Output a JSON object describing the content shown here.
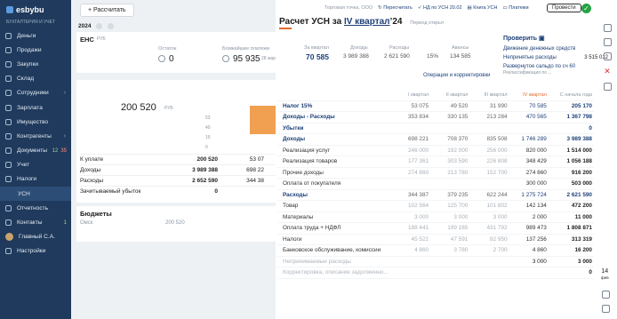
{
  "app": {
    "logo": "esbybu",
    "company": "БУХГАЛТЕРИЯ И УЧЕТ"
  },
  "sidebar": {
    "items": [
      {
        "label": "Деньги"
      },
      {
        "label": "Продажи"
      },
      {
        "label": "Закупки"
      },
      {
        "label": "Склад"
      },
      {
        "label": "Сотрудники",
        "arrow": "›"
      },
      {
        "label": "Зарплата"
      },
      {
        "label": "Имущество"
      },
      {
        "label": "Контрагенты",
        "arrow": "›"
      },
      {
        "label": "Документы",
        "badge": "12",
        "badge2": "35"
      },
      {
        "label": "Учет"
      },
      {
        "label": "Налоги"
      },
      {
        "label": "УСН"
      },
      {
        "label": "Отчетность"
      },
      {
        "label": "Контакты",
        "badge": "1"
      },
      {
        "label": "Главный С.А."
      },
      {
        "label": "Настройки"
      }
    ]
  },
  "main": {
    "calc_button": "Рассчитать",
    "year": "2024",
    "ens": {
      "title": "ЕНС",
      "currency": "РУБ",
      "balance_label": "Остаток",
      "balance_value": "0",
      "payments_label": "Ближайшие платежи",
      "payments_value": "95 935",
      "payments_date": "28 мар"
    },
    "usn": {
      "amount": "200 520",
      "currency": "РУБ",
      "chart_ticks": [
        "53",
        "40",
        "15",
        "0"
      ],
      "rows": [
        {
          "label": "К уплате",
          "value": "200 520",
          "value2": "53 07"
        },
        {
          "label": "Доходы",
          "value": "3 989 388",
          "value2": "698 22"
        },
        {
          "label": "Расходы",
          "value": "2 652 590",
          "value2": "344 38"
        },
        {
          "label": "Зачитываемый убыток",
          "value": "0",
          "value2": ""
        }
      ]
    },
    "budget": {
      "title": "Бюджеты",
      "label": "Омск",
      "value": "200 520"
    }
  },
  "panel": {
    "title_prefix": "Расчет УСН за ",
    "title_period": "IV квартал",
    "title_suffix": "’24",
    "period_status": "Период открыт",
    "links": {
      "point": "Торговая точка, ООО",
      "recalc": "Пересчитать",
      "nd": "НД по УСН 20.02",
      "book": "Книга УСН",
      "payments": "Платежи"
    },
    "check_button": "Провести",
    "calc": {
      "kv_label": "За квартал",
      "kv_value": "70 585",
      "income_label": "Доходы",
      "income_value": "3 989 388",
      "expense_label": "Расходы",
      "expense_value": "2 621 590",
      "rate": "15%",
      "adv_label": "Авансы",
      "adv_value": "134 585",
      "ops": "Операции и корректировки"
    },
    "check": {
      "title": "Проверить",
      "items": [
        {
          "label": "Движение денежных средств",
          "value": ""
        },
        {
          "label": "Непринятые расходы",
          "value": "3 515 012"
        },
        {
          "label": "Развернутое сальдо по сч 60",
          "value": ""
        }
      ],
      "more": "Реклассификация по ..."
    },
    "headers": [
      "",
      "I квартал",
      "II квартал",
      "III квартал",
      "IV квартал",
      "С начала года"
    ],
    "rows": [
      {
        "label": "Налог 15%",
        "values": [
          "53 075",
          "49 520",
          "31 990",
          "70 585",
          "205 170"
        ],
        "style": "blue"
      },
      {
        "label": "Доходы - Расходы",
        "values": [
          "353 834",
          "330 135",
          "213 284",
          "470 565",
          "1 367 798"
        ],
        "style": "blue"
      },
      {
        "label": "Убытки",
        "values": [
          "",
          "",
          "",
          "",
          "0"
        ],
        "style": "blue"
      },
      {
        "label": "Доходы",
        "values": [
          "698 221",
          "708 370",
          "835 508",
          "1 746 289",
          "3 989 388"
        ],
        "style": "blue"
      },
      {
        "label": "Реализация услуг",
        "values": [
          "246 000",
          "192 000",
          "256 000",
          "820 000",
          "1 514 000"
        ],
        "style": ""
      },
      {
        "label": "Реализация товаров",
        "values": [
          "177 361",
          "303 590",
          "226 808",
          "348 429",
          "1 056 188"
        ],
        "style": ""
      },
      {
        "label": "Прочие доходы",
        "values": [
          "274 860",
          "213 780",
          "152 700",
          "274 860",
          "916 200"
        ],
        "style": ""
      },
      {
        "label": "Оплата от покупателя",
        "values": [
          "",
          "",
          "",
          "300 000",
          "503 000"
        ],
        "style": ""
      },
      {
        "label": "Расходы",
        "values": [
          "344 387",
          "379 235",
          "622 244",
          "1 275 724",
          "2 621 590"
        ],
        "style": "blue"
      },
      {
        "label": "Товар",
        "values": [
          "102 564",
          "125 700",
          "101 802",
          "142 134",
          "472 200"
        ],
        "style": ""
      },
      {
        "label": "Материалы",
        "values": [
          "3 000",
          "3 000",
          "3 000",
          "2 000",
          "11 000"
        ],
        "style": ""
      },
      {
        "label": "Оплата труда + НДФЛ",
        "values": [
          "188 441",
          "199 165",
          "431 792",
          "989 473",
          "1 808 871"
        ],
        "style": ""
      },
      {
        "label": "Налоги",
        "values": [
          "45 522",
          "47 591",
          "82 950",
          "137 256",
          "313 319"
        ],
        "style": ""
      },
      {
        "label": "Банковское обслуживание, комиссии",
        "values": [
          "4 860",
          "3 780",
          "2 700",
          "4 860",
          "16 200"
        ],
        "style": ""
      },
      {
        "label": "Непринимаемые расходы",
        "values": [
          "",
          "",
          "",
          "3 000",
          "3 000"
        ],
        "style": "gray"
      },
      {
        "label": "Корректировка, описание задолженно...",
        "values": [
          "",
          "",
          "",
          "",
          "0"
        ],
        "style": "gray"
      }
    ]
  },
  "right_bar": {
    "calendar_day": "14",
    "calendar_month": "фев"
  }
}
